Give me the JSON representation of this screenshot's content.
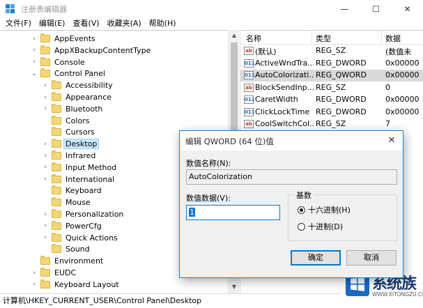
{
  "window": {
    "title": "注册表编辑器",
    "minimize": "—",
    "maximize": "☐",
    "close": "✕"
  },
  "menu": [
    "文件(F)",
    "编辑(E)",
    "查看(V)",
    "收藏夹(A)",
    "帮助(H)"
  ],
  "tree": [
    {
      "label": "AppEvents",
      "level": 1,
      "expand": "›"
    },
    {
      "label": "AppXBackupContentType",
      "level": 1,
      "expand": "›"
    },
    {
      "label": "Console",
      "level": 1,
      "expand": "›"
    },
    {
      "label": "Control Panel",
      "level": 1,
      "expand": "⌄"
    },
    {
      "label": "Accessibility",
      "level": 2,
      "expand": "›"
    },
    {
      "label": "Appearance",
      "level": 2,
      "expand": "›"
    },
    {
      "label": "Bluetooth",
      "level": 2,
      "expand": "›"
    },
    {
      "label": "Colors",
      "level": 2,
      "expand": ""
    },
    {
      "label": "Cursors",
      "level": 2,
      "expand": ""
    },
    {
      "label": "Desktop",
      "level": 2,
      "expand": "›",
      "selected": true
    },
    {
      "label": "Infrared",
      "level": 2,
      "expand": "›"
    },
    {
      "label": "Input Method",
      "level": 2,
      "expand": "›"
    },
    {
      "label": "International",
      "level": 2,
      "expand": "›"
    },
    {
      "label": "Keyboard",
      "level": 2,
      "expand": ""
    },
    {
      "label": "Mouse",
      "level": 2,
      "expand": ""
    },
    {
      "label": "Personalization",
      "level": 2,
      "expand": "›"
    },
    {
      "label": "PowerCfg",
      "level": 2,
      "expand": "›"
    },
    {
      "label": "Quick Actions",
      "level": 2,
      "expand": "›"
    },
    {
      "label": "Sound",
      "level": 2,
      "expand": ""
    },
    {
      "label": "Environment",
      "level": 1,
      "expand": ""
    },
    {
      "label": "EUDC",
      "level": 1,
      "expand": "›"
    },
    {
      "label": "Keyboard Layout",
      "level": 1,
      "expand": "›"
    }
  ],
  "list": {
    "headers": [
      "名称",
      "类型",
      "数据"
    ],
    "rows": [
      {
        "name": "(默认)",
        "type": "REG_SZ",
        "data": "(数值未",
        "icon": "sz"
      },
      {
        "name": "ActiveWndTra...",
        "type": "REG_DWORD",
        "data": "0x00000",
        "icon": "bin"
      },
      {
        "name": "AutoColorizati...",
        "type": "REG_QWORD",
        "data": "0x00000",
        "icon": "bin",
        "selected": true
      },
      {
        "name": "BlockSendInp...",
        "type": "REG_SZ",
        "data": "0",
        "icon": "sz"
      },
      {
        "name": "CaretWidth",
        "type": "REG_DWORD",
        "data": "0x00000",
        "icon": "bin"
      },
      {
        "name": "ClickLockTime",
        "type": "REG_DWORD",
        "data": "0x00000",
        "icon": "bin"
      },
      {
        "name": "CoolSwitchCol...",
        "type": "REG_SZ",
        "data": "7",
        "icon": "sz"
      }
    ]
  },
  "status": "计算机\\HKEY_CURRENT_USER\\Control Panel\\Desktop",
  "dialog": {
    "title": "编辑 QWORD (64 位)值",
    "close": "✕",
    "value_name_label": "数值名称(N):",
    "value_name": "AutoColorization",
    "value_data_label": "数值数据(V):",
    "value_data": "1",
    "base_label": "基数",
    "hex_label": "十六进制(H)",
    "dec_label": "十进制(D)",
    "ok": "确定",
    "cancel": "取消"
  },
  "watermark": {
    "text": "系统族",
    "url": "WWW.XITONGZU.COM"
  },
  "colors": {
    "accent": "#0078d7",
    "selection": "#cce8ff"
  }
}
